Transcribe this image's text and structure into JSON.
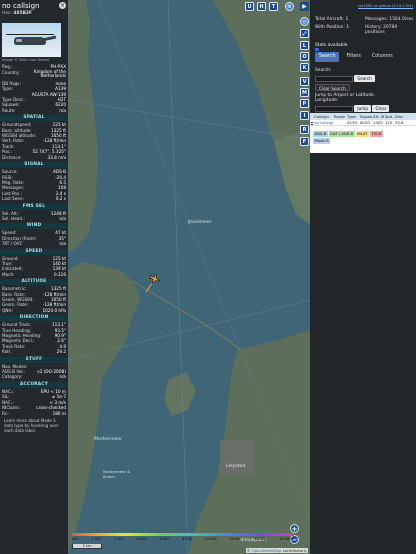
{
  "aircraft": {
    "callsign": "no callsign",
    "hex_label": "Hex:",
    "hex": "485B2F",
    "photo_credit": "Image © Dean van Hessel",
    "rows": [
      {
        "k": "Reg.:",
        "v": "PH-PXX",
        "tall": false
      },
      {
        "k": "Country:",
        "v": "Kingdom of the Netherlands",
        "tall": true
      },
      {
        "k": "DB flags:",
        "v": "none",
        "tall": false
      },
      {
        "k": "Type:",
        "v": "A139",
        "tall": false
      },
      {
        "k": "",
        "v": "AGUSTA AW-139",
        "tall": false
      },
      {
        "k": "Type Desc.:",
        "v": "H2T",
        "tall": false
      },
      {
        "k": "Squawk:",
        "v": "6220",
        "tall": false
      },
      {
        "k": "Route:",
        "v": "n/a",
        "tall": false
      }
    ],
    "sections": [
      {
        "title": "SPATIAL",
        "rows": [
          {
            "k": "Groundspeed:",
            "v": "125 kt"
          },
          {
            "k": "Baro. altitude:",
            "v": "1325 ft"
          },
          {
            "k": "WGS84 altitude:",
            "v": "1650 ft"
          },
          {
            "k": "Vert. Rate:",
            "v": "-128 ft/min"
          },
          {
            "k": "Track:",
            "v": "113.1°"
          },
          {
            "k": "Pos.:",
            "v": "52.747°, 5.325°"
          },
          {
            "k": "Distance:",
            "v": "33.8 nmi"
          }
        ]
      },
      {
        "title": "SIGNAL",
        "rows": [
          {
            "k": "Source:",
            "v": "ADS-B"
          },
          {
            "k": "RSSI:",
            "v": "-20.4"
          },
          {
            "k": "Msg. Rate:",
            "v": "6.5"
          },
          {
            "k": "Messages:",
            "v": "108"
          },
          {
            "k": "Last Pos.:",
            "v": "2.4 s"
          },
          {
            "k": "Last Seen:",
            "v": "0.2 s"
          }
        ]
      },
      {
        "title": "FMS SEL",
        "rows": [
          {
            "k": "Sel. Alt.:",
            "v": "1248 ft"
          },
          {
            "k": "Sel. Head.:",
            "v": "n/a"
          }
        ]
      },
      {
        "title": "WIND",
        "rows": [
          {
            "k": "Speed:",
            "v": "47 kt"
          },
          {
            "k": "Direction (from):",
            "v": "35°"
          },
          {
            "k": "TAT / OAT:",
            "v": "n/a"
          }
        ]
      },
      {
        "title": "SPEED",
        "rows": [
          {
            "k": "Ground:",
            "v": "125 kt"
          },
          {
            "k": "True:",
            "v": "140 kt"
          },
          {
            "k": "Indicated:",
            "v": "139 kt"
          },
          {
            "k": "Mach:",
            "v": "0.216"
          }
        ]
      },
      {
        "title": "ALTITUDE",
        "rows": [
          {
            "k": "Barometric:",
            "v": "1325 ft"
          },
          {
            "k": "Baro. Rate:",
            "v": "-128 ft/min"
          },
          {
            "k": "Geom. WGS84:",
            "v": "1650 ft"
          },
          {
            "k": "Geom. Rate:",
            "v": "-128 ft/min"
          },
          {
            "k": "QNH:",
            "v": "1020.0 hPa"
          }
        ]
      },
      {
        "title": "DIRECTION",
        "rows": [
          {
            "k": "Ground Track:",
            "v": "113.1°"
          },
          {
            "k": "True Heading:",
            "v": "93.5°"
          },
          {
            "k": "Magnetic Heading:",
            "v": "90.9°"
          },
          {
            "k": "Magnetic Decl.:",
            "v": "2.6°"
          },
          {
            "k": "Track Rate:",
            "v": "4.9"
          },
          {
            "k": "Roll:",
            "v": "29.2"
          }
        ]
      },
      {
        "title": "STUFF",
        "rows": [
          {
            "k": "Nav. Modes:",
            "v": ""
          },
          {
            "k": "ADS-B Ver.:",
            "v": "v2 (DO-260B)"
          },
          {
            "k": "Category:",
            "v": "n/a"
          }
        ]
      },
      {
        "title": "ACCURACY",
        "rows": [
          {
            "k": "NACₚ:",
            "v": "EPU < 10 m"
          },
          {
            "k": "SIL:",
            "v": "≤ 1e-7"
          },
          {
            "k": "NACᵥ:",
            "v": "< 3 m/s"
          },
          {
            "k": "NICbaro:",
            "v": "cross-checked"
          },
          {
            "k": "Rc:",
            "v": "186 m"
          }
        ]
      }
    ],
    "note": "Learn more about Mode S data type by hovering over each data label."
  },
  "map": {
    "labels": {
      "ijsselmeer": "IJsselmeer",
      "markermeer": "Markermeer",
      "markermeer_ijmeer": "Markermeer & IJmeer",
      "lelystad": "Lelystad",
      "ijmuiden": "Nieuwpoort"
    },
    "buttons_top": [
      "U",
      "H",
      "T"
    ],
    "buttons_side": [
      "L",
      "O",
      "K",
      "V",
      "M",
      "P",
      "I",
      "R",
      "F"
    ],
    "zoom_in": "+",
    "zoom_out": "−",
    "scale_label": "5 km",
    "altitude_ticks": [
      "600",
      "1 000",
      "2 000",
      "4 000",
      "6 000",
      "8 000",
      "10 000",
      "20 000",
      "30 000",
      "40 000+"
    ],
    "attribution_prefix": "© ",
    "attribution_link": "OpenStreetMap",
    "attribution_suffix": " contributors."
  },
  "sidebar": {
    "top_link": "tar1090 on github (3.14.1701)",
    "toggle": "▶",
    "stats": [
      {
        "l": "Total Aircraft: 1",
        "r": "Messages: 1564.0/sec"
      },
      {
        "l": "With Position: 1",
        "r": "History: 29789 positions"
      }
    ],
    "stats_link": "Stats available",
    "tabs": [
      {
        "label": "Search",
        "active": true
      },
      {
        "label": "Filters",
        "active": false
      },
      {
        "label": "Columns",
        "active": false
      }
    ],
    "search_label": "Search:",
    "search_button": "Search",
    "clear_search": "Clear Search",
    "jump_label": "Jump to Airport or Latitude, Longitude:",
    "jump_button": "Jump",
    "clear_button": "Clear",
    "table": {
      "headers": [
        "",
        "Callsign",
        "Route",
        "Type",
        "Squawk",
        "Alt. (ft)",
        "Spd. (kt)",
        "Dist."
      ],
      "rows": [
        {
          "callsign": "no callsign",
          "route": "",
          "type": "A139",
          "squawk": "6220",
          "alt": "1325",
          "spd": "125",
          "dist": "33.8"
        }
      ]
    },
    "sources": [
      "ADS-B",
      "UAT / ADS-R",
      "MLAT",
      "TIS-B"
    ],
    "mode_s": "Mode-S"
  }
}
